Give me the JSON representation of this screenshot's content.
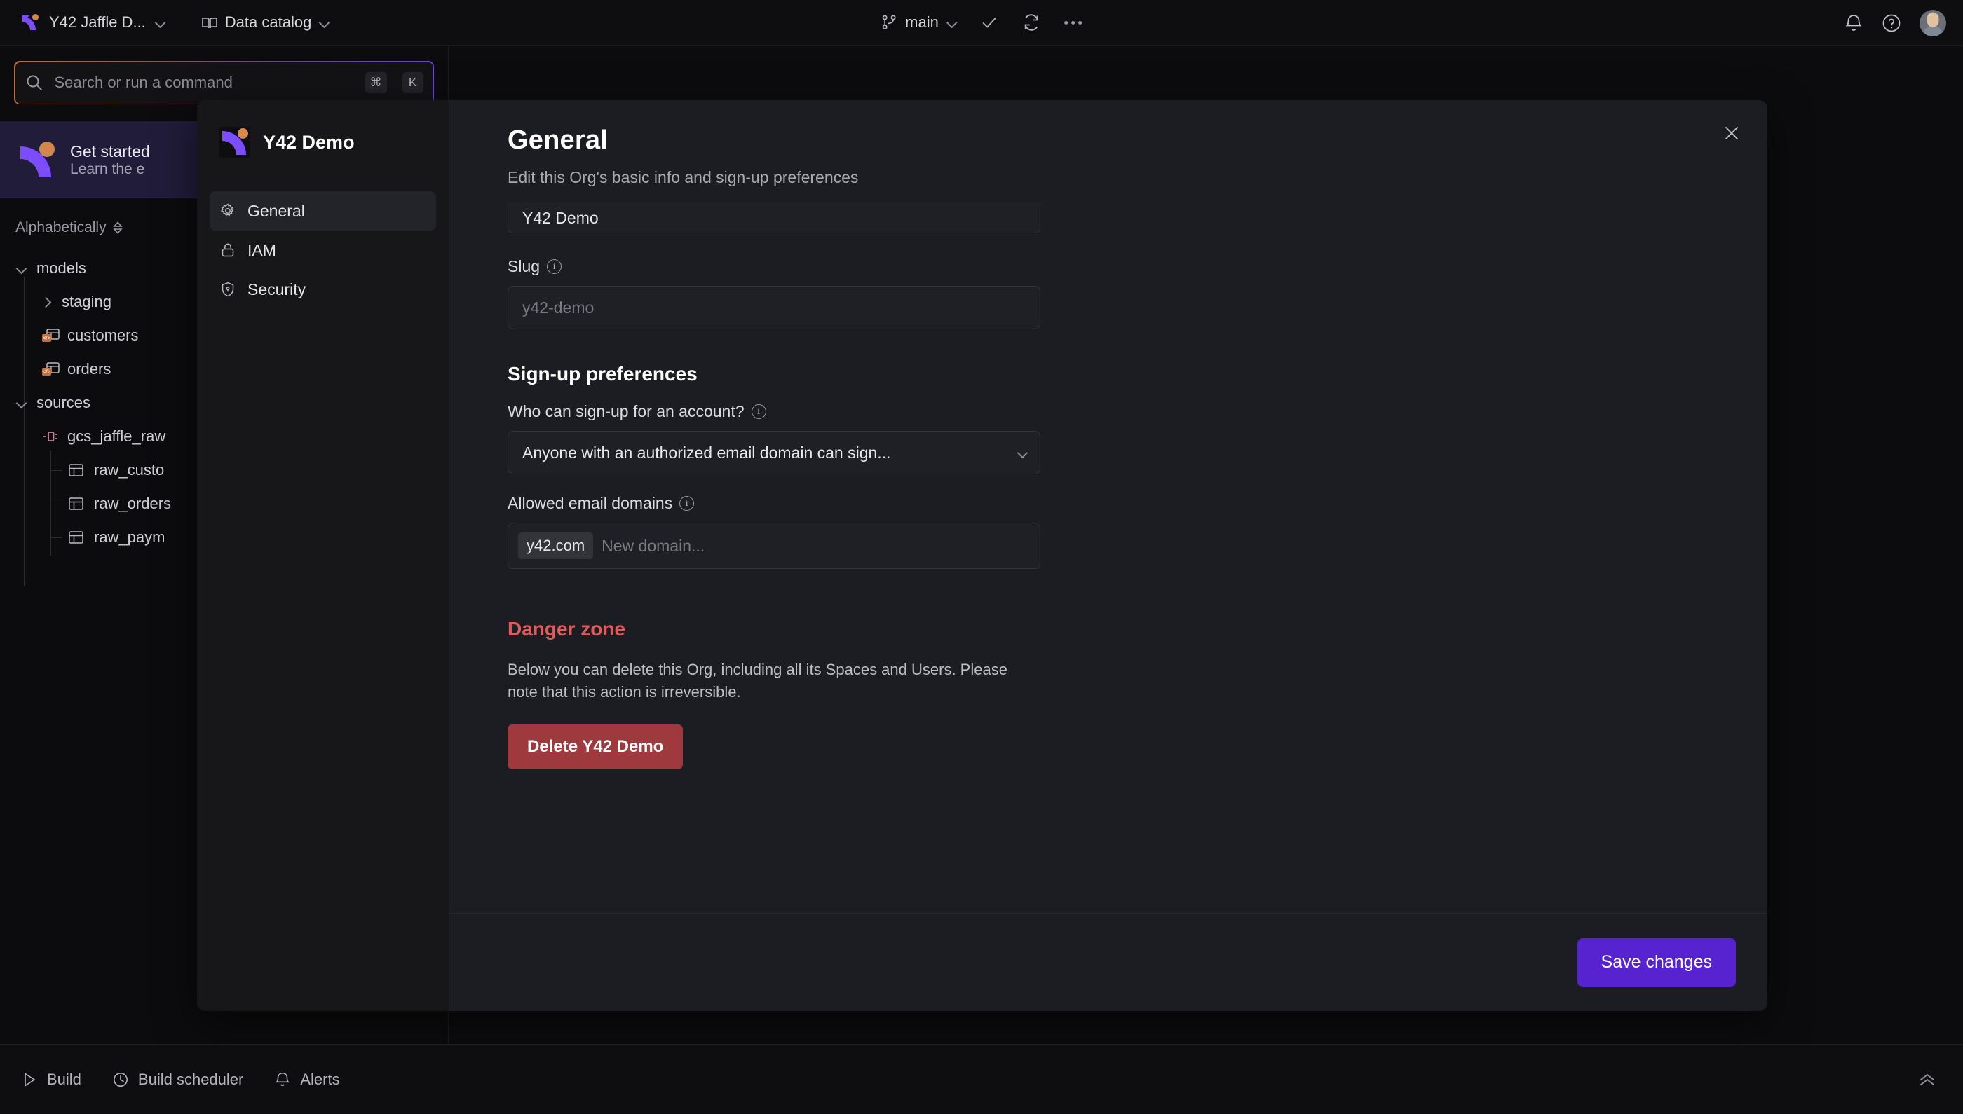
{
  "topbar": {
    "org_name": "Y42 Jaffle D...",
    "catalog_label": "Data catalog",
    "branch_name": "main",
    "icons": {
      "org_chevron": "chevron-down-icon",
      "book": "book-icon",
      "catalog_chevron": "chevron-down-icon",
      "branch": "git-branch-icon",
      "branch_chevron": "chevron-down-icon",
      "check": "check-icon",
      "refresh": "refresh-icon",
      "more": "more-horizontal-icon",
      "bell": "bell-icon",
      "help": "help-circle-icon",
      "avatar": "user-avatar"
    }
  },
  "sidebar": {
    "search": {
      "placeholder": "Search or run a command",
      "shortcut_modifier": "⌘",
      "shortcut_key": "K"
    },
    "get_started": {
      "title": "Get started",
      "subtitle": "Learn the e"
    },
    "sort_label": "Alphabetically",
    "tree": [
      {
        "label": "models",
        "level": 0,
        "kind": "folder",
        "expanded": true
      },
      {
        "label": "staging",
        "level": 1,
        "kind": "folder",
        "expanded": false
      },
      {
        "label": "customers",
        "level": 1,
        "kind": "model"
      },
      {
        "label": "orders",
        "level": 1,
        "kind": "model"
      },
      {
        "label": "sources",
        "level": 0,
        "kind": "folder",
        "expanded": true
      },
      {
        "label": "gcs_jaffle_raw",
        "level": 1,
        "kind": "source"
      },
      {
        "label": "raw_custo",
        "level": 2,
        "kind": "table"
      },
      {
        "label": "raw_orders",
        "level": 2,
        "kind": "table"
      },
      {
        "label": "raw_paym",
        "level": 2,
        "kind": "table"
      }
    ]
  },
  "modal": {
    "nav": {
      "org_title": "Y42 Demo",
      "items": [
        {
          "label": "General",
          "icon": "gear-icon",
          "active": true
        },
        {
          "label": "IAM",
          "icon": "lock-icon",
          "active": false
        },
        {
          "label": "Security",
          "icon": "shield-icon",
          "active": false
        }
      ]
    },
    "close_icon": "close-icon",
    "content": {
      "title": "General",
      "subtitle": "Edit this Org's basic info and sign-up preferences",
      "org_name_value": "Y42 Demo",
      "slug_label": "Slug",
      "slug_placeholder": "y42-demo",
      "signup_section_title": "Sign-up preferences",
      "who_label": "Who can sign-up for an account?",
      "who_value": "Anyone with an authorized email domain can sign...",
      "domains_label": "Allowed email domains",
      "domain_chips": [
        "y42.com"
      ],
      "domain_placeholder": "New domain...",
      "danger_title": "Danger zone",
      "danger_text": "Below you can delete this Org, including all its Spaces and Users. Please note that this action is irreversible.",
      "delete_button": "Delete Y42 Demo",
      "save_button": "Save changes"
    }
  },
  "bottombar": {
    "items": [
      {
        "label": "Build",
        "icon": "play-icon"
      },
      {
        "label": "Build scheduler",
        "icon": "clock-icon"
      },
      {
        "label": "Alerts",
        "icon": "bell-icon"
      }
    ],
    "collapse_icon": "chevrons-up-icon"
  },
  "colors": {
    "accent_purple": "#5723d0",
    "brand_purple": "#7c4dff",
    "brand_orange": "#d1884f",
    "danger_red": "#e05b5b",
    "delete_button_red": "#9e3a3e",
    "app_bg": "#0c0c0e",
    "modal_bg": "#1c1d22",
    "modal_nav_bg": "#171719"
  }
}
